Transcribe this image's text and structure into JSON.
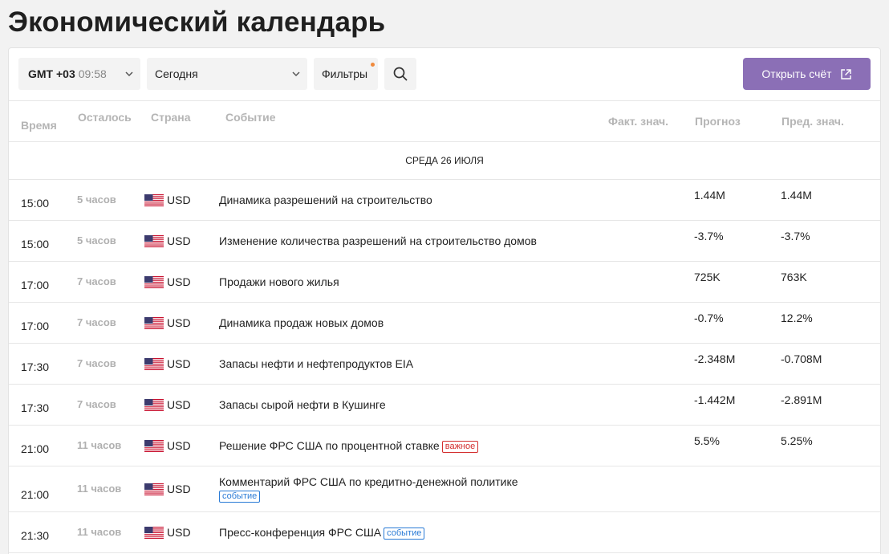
{
  "page_title": "Экономический календарь",
  "toolbar": {
    "tz_label": "GMT +03",
    "tz_time": "09:58",
    "day_select": "Сегодня",
    "filters_label": "Фильтры",
    "open_account_label": "Открыть счёт"
  },
  "columns": {
    "time": "Время",
    "remaining": "Осталось",
    "country": "Страна",
    "event": "Событие",
    "actual": "Факт. знач.",
    "forecast": "Прогноз",
    "previous": "Пред. знач."
  },
  "date_header": "СРЕДА 26 ИЮЛЯ",
  "rows": [
    {
      "time": "15:00",
      "left": "5 часов",
      "currency": "USD",
      "event": "Динамика разрешений на строительство",
      "forecast": "1.44M",
      "prev": "1.44M"
    },
    {
      "time": "15:00",
      "left": "5 часов",
      "currency": "USD",
      "event": "Изменение количества разрешений на строительство домов",
      "forecast": "-3.7%",
      "prev": "-3.7%"
    },
    {
      "time": "17:00",
      "left": "7 часов",
      "currency": "USD",
      "event": "Продажи нового жилья",
      "forecast": "725K",
      "prev": "763K"
    },
    {
      "time": "17:00",
      "left": "7 часов",
      "currency": "USD",
      "event": "Динамика продаж новых домов",
      "forecast": "-0.7%",
      "prev": "12.2%"
    },
    {
      "time": "17:30",
      "left": "7 часов",
      "currency": "USD",
      "event": "Запасы нефти и нефтепродуктов EIA",
      "forecast": "-2.348M",
      "prev": "-0.708M"
    },
    {
      "time": "17:30",
      "left": "7 часов",
      "currency": "USD",
      "event": "Запасы сырой нефти в Кушинге",
      "forecast": "-1.442M",
      "prev": "-2.891M"
    },
    {
      "time": "21:00",
      "left": "11 часов",
      "currency": "USD",
      "event": "Решение ФРС США по процентной ставке",
      "badge": "важное",
      "forecast": "5.5%",
      "prev": "5.25%"
    },
    {
      "time": "21:00",
      "left": "11 часов",
      "currency": "USD",
      "event": "Комментарий ФРС США по кредитно-денежной политике",
      "badge": "событие"
    },
    {
      "time": "21:30",
      "left": "11 часов",
      "currency": "USD",
      "event": "Пресс-конференция ФРС США",
      "badge": "событие"
    }
  ],
  "colors": {
    "accent": "#8b6fb6",
    "important": "#d32f2f",
    "event_badge": "#2a7bd6",
    "filter_dot": "#f08a3c"
  }
}
